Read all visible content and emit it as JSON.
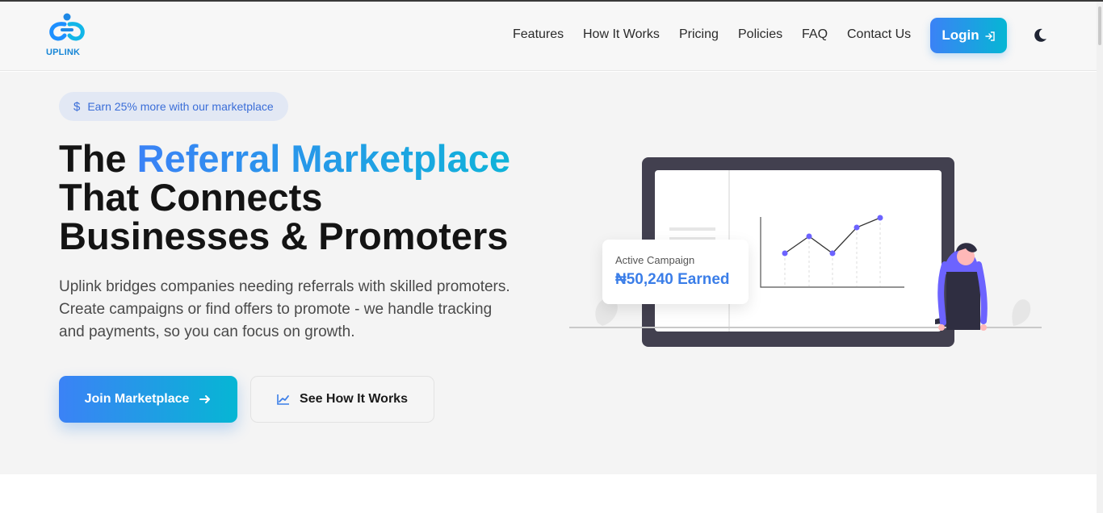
{
  "brand": {
    "name": "UPLINK",
    "logo_icon": "uplink-logo-icon",
    "accent_start": "#3b82f6",
    "accent_end": "#06b6d4"
  },
  "nav": {
    "items": [
      {
        "label": "Features"
      },
      {
        "label": "How It Works"
      },
      {
        "label": "Pricing"
      },
      {
        "label": "Policies"
      },
      {
        "label": "FAQ"
      },
      {
        "label": "Contact Us"
      }
    ],
    "login_label": "Login",
    "login_icon": "login-arrow-icon",
    "theme_toggle_icon": "moon-icon"
  },
  "hero": {
    "badge": {
      "icon": "dollar-icon",
      "text": "Earn 25% more with our marketplace"
    },
    "title_prefix": "The ",
    "title_highlight": "Referral Marketplace",
    "title_line2": "That Connects",
    "title_line3": "Businesses & Promoters",
    "description": "Uplink bridges companies needing referrals with skilled promoters. Create campaigns or find offers to promote - we handle tracking and payments, so you can focus on growth.",
    "primary_button": {
      "label": "Join Marketplace",
      "icon": "arrow-right-icon"
    },
    "secondary_button": {
      "label": "See How It Works",
      "icon": "chart-line-icon"
    }
  },
  "illustration": {
    "card_label": "Active Campaign",
    "card_value": "₦50,240 Earned"
  }
}
